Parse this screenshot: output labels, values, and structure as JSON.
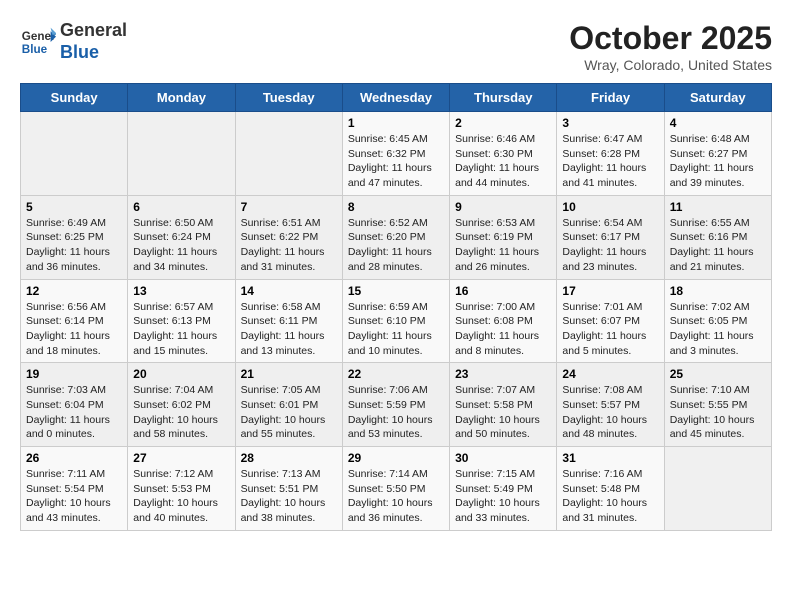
{
  "header": {
    "logo_line1": "General",
    "logo_line2": "Blue",
    "title": "October 2025",
    "location": "Wray, Colorado, United States"
  },
  "days_of_week": [
    "Sunday",
    "Monday",
    "Tuesday",
    "Wednesday",
    "Thursday",
    "Friday",
    "Saturday"
  ],
  "weeks": [
    [
      {
        "day": "",
        "info": ""
      },
      {
        "day": "",
        "info": ""
      },
      {
        "day": "",
        "info": ""
      },
      {
        "day": "1",
        "info": "Sunrise: 6:45 AM\nSunset: 6:32 PM\nDaylight: 11 hours and 47 minutes."
      },
      {
        "day": "2",
        "info": "Sunrise: 6:46 AM\nSunset: 6:30 PM\nDaylight: 11 hours and 44 minutes."
      },
      {
        "day": "3",
        "info": "Sunrise: 6:47 AM\nSunset: 6:28 PM\nDaylight: 11 hours and 41 minutes."
      },
      {
        "day": "4",
        "info": "Sunrise: 6:48 AM\nSunset: 6:27 PM\nDaylight: 11 hours and 39 minutes."
      }
    ],
    [
      {
        "day": "5",
        "info": "Sunrise: 6:49 AM\nSunset: 6:25 PM\nDaylight: 11 hours and 36 minutes."
      },
      {
        "day": "6",
        "info": "Sunrise: 6:50 AM\nSunset: 6:24 PM\nDaylight: 11 hours and 34 minutes."
      },
      {
        "day": "7",
        "info": "Sunrise: 6:51 AM\nSunset: 6:22 PM\nDaylight: 11 hours and 31 minutes."
      },
      {
        "day": "8",
        "info": "Sunrise: 6:52 AM\nSunset: 6:20 PM\nDaylight: 11 hours and 28 minutes."
      },
      {
        "day": "9",
        "info": "Sunrise: 6:53 AM\nSunset: 6:19 PM\nDaylight: 11 hours and 26 minutes."
      },
      {
        "day": "10",
        "info": "Sunrise: 6:54 AM\nSunset: 6:17 PM\nDaylight: 11 hours and 23 minutes."
      },
      {
        "day": "11",
        "info": "Sunrise: 6:55 AM\nSunset: 6:16 PM\nDaylight: 11 hours and 21 minutes."
      }
    ],
    [
      {
        "day": "12",
        "info": "Sunrise: 6:56 AM\nSunset: 6:14 PM\nDaylight: 11 hours and 18 minutes."
      },
      {
        "day": "13",
        "info": "Sunrise: 6:57 AM\nSunset: 6:13 PM\nDaylight: 11 hours and 15 minutes."
      },
      {
        "day": "14",
        "info": "Sunrise: 6:58 AM\nSunset: 6:11 PM\nDaylight: 11 hours and 13 minutes."
      },
      {
        "day": "15",
        "info": "Sunrise: 6:59 AM\nSunset: 6:10 PM\nDaylight: 11 hours and 10 minutes."
      },
      {
        "day": "16",
        "info": "Sunrise: 7:00 AM\nSunset: 6:08 PM\nDaylight: 11 hours and 8 minutes."
      },
      {
        "day": "17",
        "info": "Sunrise: 7:01 AM\nSunset: 6:07 PM\nDaylight: 11 hours and 5 minutes."
      },
      {
        "day": "18",
        "info": "Sunrise: 7:02 AM\nSunset: 6:05 PM\nDaylight: 11 hours and 3 minutes."
      }
    ],
    [
      {
        "day": "19",
        "info": "Sunrise: 7:03 AM\nSunset: 6:04 PM\nDaylight: 11 hours and 0 minutes."
      },
      {
        "day": "20",
        "info": "Sunrise: 7:04 AM\nSunset: 6:02 PM\nDaylight: 10 hours and 58 minutes."
      },
      {
        "day": "21",
        "info": "Sunrise: 7:05 AM\nSunset: 6:01 PM\nDaylight: 10 hours and 55 minutes."
      },
      {
        "day": "22",
        "info": "Sunrise: 7:06 AM\nSunset: 5:59 PM\nDaylight: 10 hours and 53 minutes."
      },
      {
        "day": "23",
        "info": "Sunrise: 7:07 AM\nSunset: 5:58 PM\nDaylight: 10 hours and 50 minutes."
      },
      {
        "day": "24",
        "info": "Sunrise: 7:08 AM\nSunset: 5:57 PM\nDaylight: 10 hours and 48 minutes."
      },
      {
        "day": "25",
        "info": "Sunrise: 7:10 AM\nSunset: 5:55 PM\nDaylight: 10 hours and 45 minutes."
      }
    ],
    [
      {
        "day": "26",
        "info": "Sunrise: 7:11 AM\nSunset: 5:54 PM\nDaylight: 10 hours and 43 minutes."
      },
      {
        "day": "27",
        "info": "Sunrise: 7:12 AM\nSunset: 5:53 PM\nDaylight: 10 hours and 40 minutes."
      },
      {
        "day": "28",
        "info": "Sunrise: 7:13 AM\nSunset: 5:51 PM\nDaylight: 10 hours and 38 minutes."
      },
      {
        "day": "29",
        "info": "Sunrise: 7:14 AM\nSunset: 5:50 PM\nDaylight: 10 hours and 36 minutes."
      },
      {
        "day": "30",
        "info": "Sunrise: 7:15 AM\nSunset: 5:49 PM\nDaylight: 10 hours and 33 minutes."
      },
      {
        "day": "31",
        "info": "Sunrise: 7:16 AM\nSunset: 5:48 PM\nDaylight: 10 hours and 31 minutes."
      },
      {
        "day": "",
        "info": ""
      }
    ]
  ]
}
